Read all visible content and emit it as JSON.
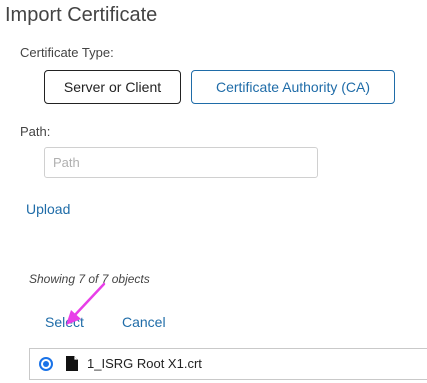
{
  "dialog": {
    "title": "Import Certificate",
    "certificate_type_label": "Certificate Type:",
    "type_options": [
      "Server or Client",
      "Certificate Authority (CA)"
    ],
    "selected_type": "Server or Client",
    "path_label": "Path:",
    "path_value": "",
    "path_placeholder": "Path",
    "upload_label": "Upload"
  },
  "list": {
    "showing_text": "Showing 7 of 7 objects",
    "select_label": "Select",
    "cancel_label": "Cancel",
    "items": [
      {
        "name": "1_ISRG Root X1.crt",
        "selected": true,
        "icon": "file-icon"
      }
    ]
  },
  "colors": {
    "accent": "#1f6ca8",
    "radio": "#1a73e8",
    "pointer_arrow": "#e83ee8"
  }
}
